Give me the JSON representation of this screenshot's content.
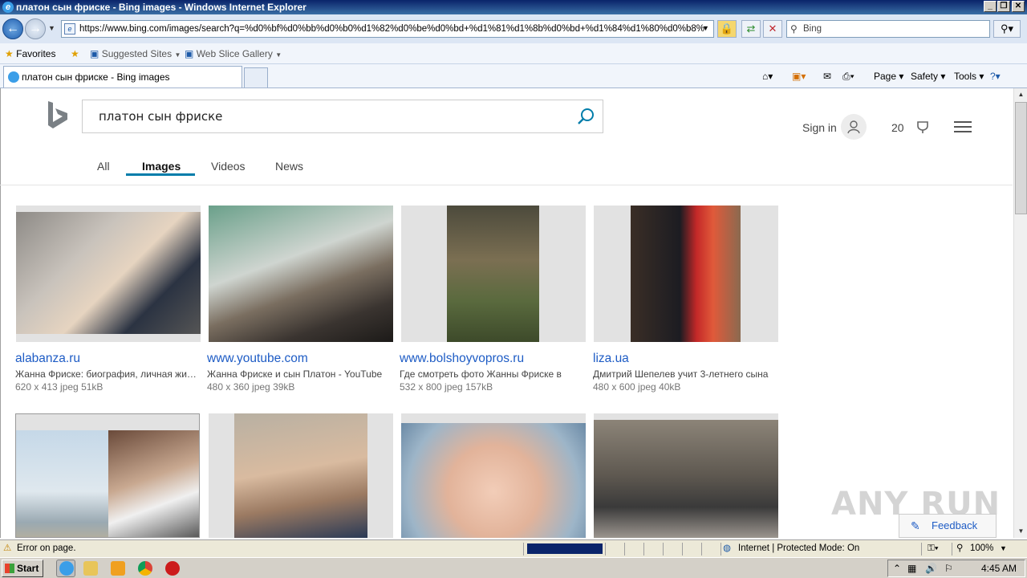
{
  "window": {
    "title": "платон сын фриске - Bing images - Windows Internet Explorer",
    "controls": [
      "_",
      "❐",
      "✕"
    ]
  },
  "address_bar": {
    "url": "https://www.bing.com/images/search?q=%d0%bf%d0%bb%d0%b0%d1%82%d0%be%d0%bd+%d1%81%d1%8b%d0%bd+%d1%84%d1%80%d0%b8%",
    "search_value": "Bing"
  },
  "favorites_bar": {
    "favorites_label": "Favorites",
    "suggested_sites": "Suggested Sites",
    "web_slice_gallery": "Web Slice Gallery"
  },
  "tabs": {
    "active_tab_title": "платон сын фриске - Bing images"
  },
  "command_bar": {
    "page": "Page",
    "safety": "Safety",
    "tools": "Tools"
  },
  "bing": {
    "query": "платон сын фриске",
    "sign_in": "Sign in",
    "rewards_count": "20",
    "nav": [
      "All",
      "Images",
      "Videos",
      "News"
    ],
    "results": [
      {
        "domain": "alabanza.ru",
        "caption": "Жанна Фриске: биография, личная жизнь",
        "meta": "620 x 413 jpeg 51kB"
      },
      {
        "domain": "www.youtube.com",
        "caption": "Жанна Фриске и сын Платон - YouTube",
        "meta": "480 x 360 jpeg 39kB"
      },
      {
        "domain": "www.bolshoyvopros.ru",
        "caption": "Где смотреть фото Жанны Фриске в",
        "meta": "532 x 800 jpeg 157kB"
      },
      {
        "domain": "liza.ua",
        "caption": "Дмитрий Шепелев учит 3-летнего сына",
        "meta": "480 x 600 jpeg 40kB"
      }
    ],
    "feedback": "Feedback",
    "watermark": "ANY RUN"
  },
  "status_bar": {
    "message": "Error on page.",
    "zone": "Internet | Protected Mode: On",
    "zoom": "100%"
  },
  "taskbar": {
    "start": "Start",
    "clock": "4:45 AM"
  },
  "colors": {
    "bing_accent": "#007daa",
    "link": "#1e5cc5"
  }
}
